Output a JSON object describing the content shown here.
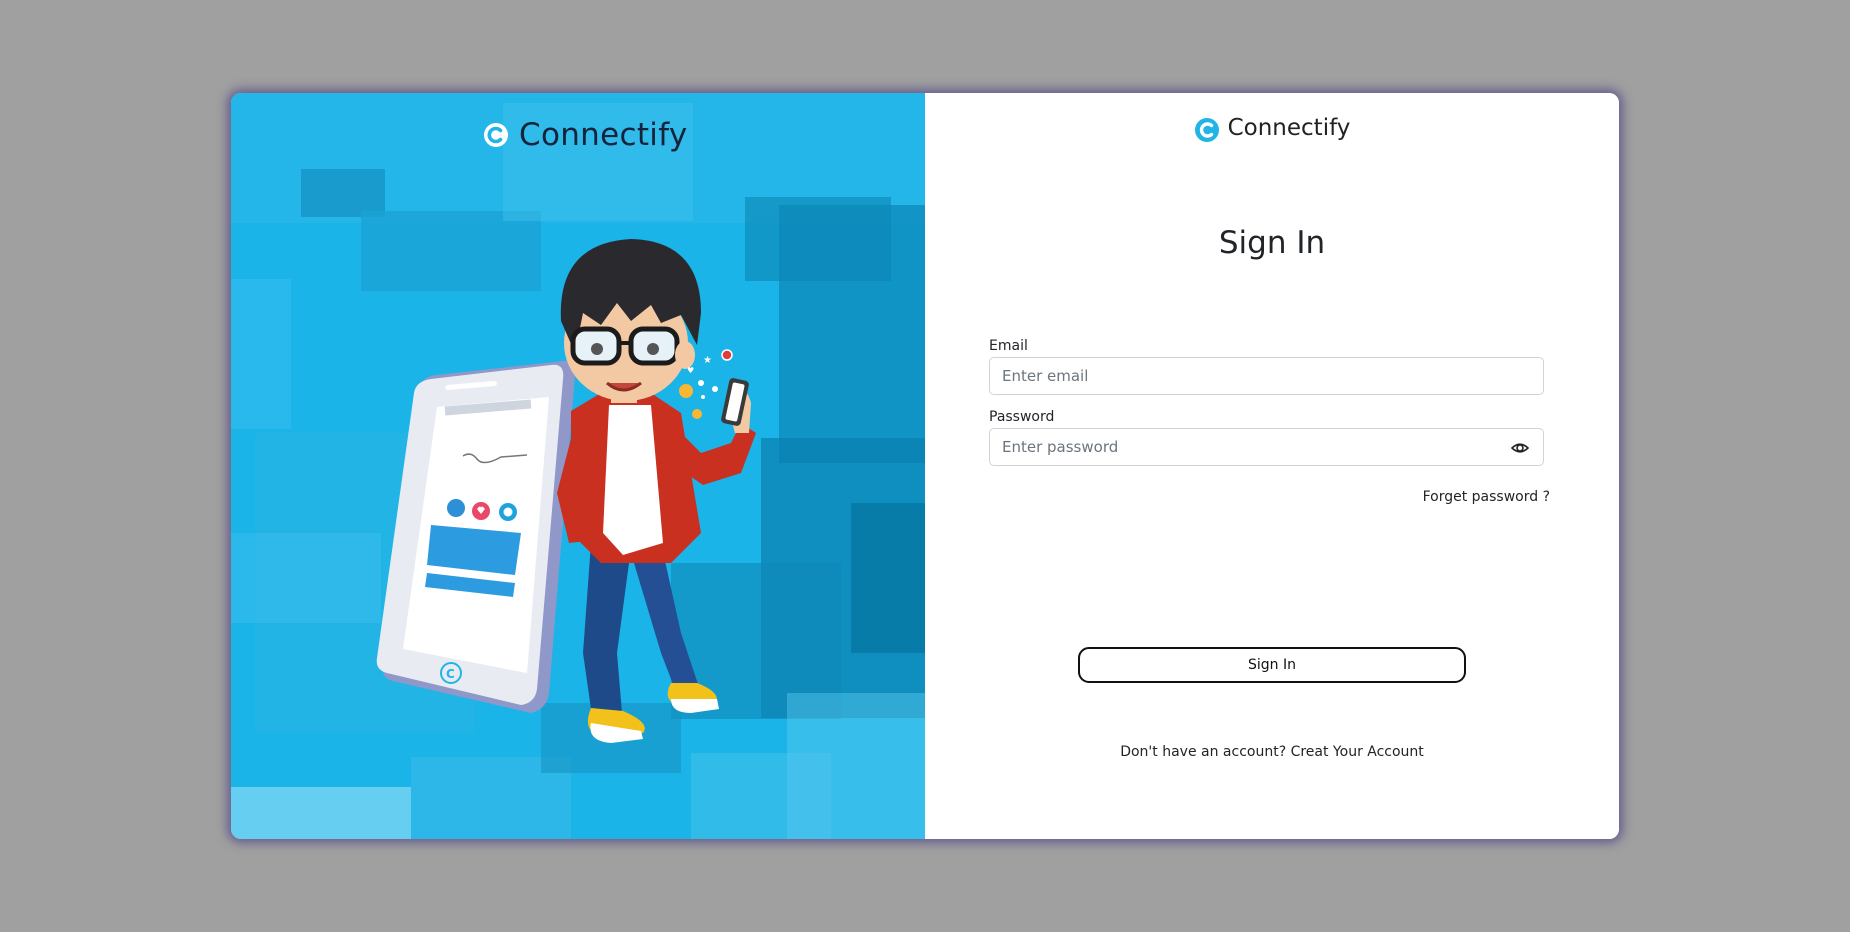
{
  "brand": {
    "name": "Connectify",
    "logo_icon": "connectify-c-logo-icon",
    "accent_color": "#20b5e6"
  },
  "left_panel": {
    "background_color": "#1ab4e8",
    "illustration": "boy-with-phone-illustration"
  },
  "form": {
    "title": "Sign In",
    "email": {
      "label": "Email",
      "placeholder": "Enter email",
      "value": ""
    },
    "password": {
      "label": "Password",
      "placeholder": "Enter password",
      "value": "",
      "toggle_icon": "eye-icon"
    },
    "forget_password": "Forget password ?",
    "submit_label": "Sign In",
    "footer": {
      "prompt": "Don't have an account?",
      "link": "Creat Your Account"
    }
  }
}
